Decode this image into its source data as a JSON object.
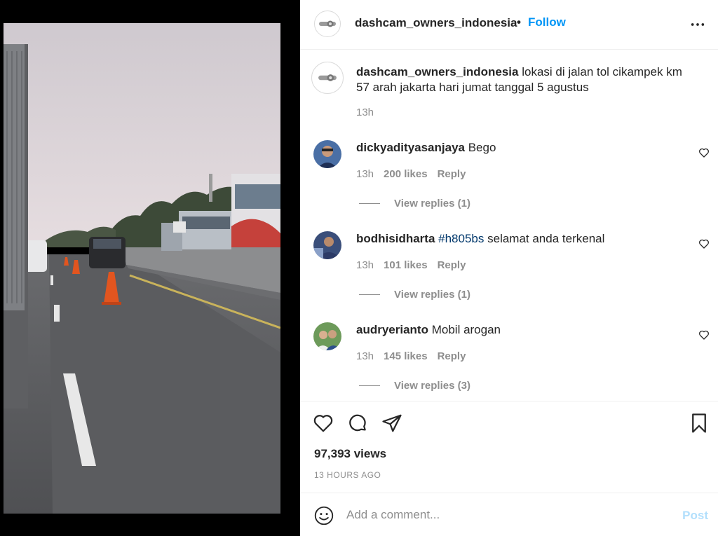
{
  "header": {
    "username": "dashcam_owners_indonesia",
    "separator": "•",
    "follow_label": "Follow"
  },
  "caption": {
    "username": "dashcam_owners_indonesia",
    "text": "lokasi di jalan tol cikampek km 57 arah jakarta hari jumat tanggal 5 agustus",
    "time": "13h"
  },
  "comments": [
    {
      "username": "dickyadityasanjaya",
      "hashtag": "",
      "text": "Bego",
      "time": "13h",
      "likes": "200 likes",
      "reply_label": "Reply",
      "view_replies": "View replies (1)"
    },
    {
      "username": "bodhisidharta",
      "hashtag": "#h805bs",
      "text": "selamat anda terkenal",
      "time": "13h",
      "likes": "101 likes",
      "reply_label": "Reply",
      "view_replies": "View replies (1)"
    },
    {
      "username": "audryerianto",
      "hashtag": "",
      "text": "Mobil arogan",
      "time": "13h",
      "likes": "145 likes",
      "reply_label": "Reply",
      "view_replies": "View replies (3)"
    }
  ],
  "stats": {
    "views": "97,393 views",
    "time_ago": "13 HOURS AGO"
  },
  "add_comment": {
    "placeholder": "Add a comment...",
    "post_label": "Post"
  },
  "icons": {
    "like": "heart-icon",
    "comment": "comment-bubble-icon",
    "share": "paper-plane-icon",
    "save": "bookmark-icon",
    "more": "more-horizontal-icon",
    "emoji": "emoji-smile-icon"
  },
  "colors": {
    "accent": "#0095f6",
    "hashtag": "#00376b",
    "muted": "#8e8e8e",
    "post_disabled": "#b2dffc"
  }
}
